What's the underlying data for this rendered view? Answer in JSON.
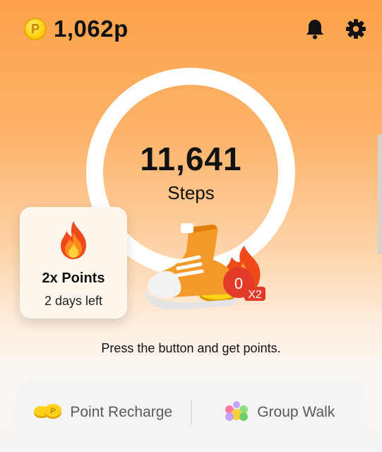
{
  "header": {
    "coin_symbol": "P",
    "points": "1,062p",
    "icons": [
      "bell-icon",
      "gear-icon"
    ]
  },
  "progress": {
    "steps": "11,641",
    "steps_label": "Steps"
  },
  "bonus": {
    "icon": "fire-icon",
    "title": "2x Points",
    "subtitle": "2 days left"
  },
  "reward": {
    "count": "0",
    "multiplier": "X2"
  },
  "hint": "Press the button and get points.",
  "actions": [
    {
      "icon": "coins-icon",
      "label": "Point Recharge"
    },
    {
      "icon": "group-icon",
      "label": "Group Walk"
    }
  ],
  "colors": {
    "accent": "#fda24a",
    "coin": "#ffd21a",
    "shoe": "#f39a2a",
    "badge": "#e23b2a"
  }
}
